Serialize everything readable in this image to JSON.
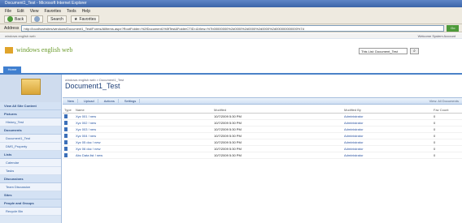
{
  "browser": {
    "title": "Document1_Test - Microsoft Internet Explorer",
    "menu": [
      "File",
      "Edit",
      "View",
      "Favorites",
      "Tools",
      "Help"
    ],
    "toolbar": {
      "back": "Back",
      "search": "Search",
      "favorites": "Favorites"
    },
    "address_label": "Address",
    "address": "http://localhost/sites/windows/Document1_Test/Forms/AllItems.aspx?RootFolder=%2fDocument1%5fTest&FolderCTID=&View=%7b00000000%2d0000%2d0000%2d0000%2d000000000000%7d",
    "go": "Go"
  },
  "site": {
    "top_left": "windows english web",
    "top_right": "Welcome System Account",
    "title": "windows english web",
    "search_placeholder": "This List: Document_Test",
    "home_tab": "Home"
  },
  "quick_launch": {
    "sections": [
      {
        "title": "View All Site Content",
        "items": []
      },
      {
        "title": "Pictures",
        "items": [
          "History_Test"
        ]
      },
      {
        "title": "Documents",
        "items": [
          "Document1_Test",
          "DMS_Property"
        ]
      },
      {
        "title": "Lists",
        "items": [
          "Calendar",
          "Tasks"
        ]
      },
      {
        "title": "Discussions",
        "items": [
          "Team Discussion"
        ]
      },
      {
        "title": "Sites",
        "items": []
      },
      {
        "title": "People and Groups",
        "items": [
          "Recycle Bin"
        ]
      }
    ]
  },
  "content": {
    "breadcrumb": "windows english web > Document1_Test",
    "title": "Document1_Test",
    "actions": [
      "New",
      "Upload",
      "Actions",
      "Settings"
    ],
    "view_label": "View: All Documents",
    "columns": [
      "Type",
      "Name",
      "Modified",
      "Modified By",
      "Fav Count"
    ],
    "rows": [
      {
        "name": "Xyz 001 ! new",
        "modified": "10/7/2009 5:30 PM",
        "by": "Administrator",
        "count": "0"
      },
      {
        "name": "Xyz 002 ! new",
        "modified": "10/7/2009 5:30 PM",
        "by": "Administrator",
        "count": "0"
      },
      {
        "name": "Xyz 003 ! new",
        "modified": "10/7/2009 5:30 PM",
        "by": "Administrator",
        "count": "0"
      },
      {
        "name": "Xyz 004 ! new",
        "modified": "10/7/2009 5:30 PM",
        "by": "Administrator",
        "count": "0"
      },
      {
        "name": "Xyz 05 doc ! new",
        "modified": "10/7/2009 5:30 PM",
        "by": "Administrator",
        "count": "0"
      },
      {
        "name": "Xyz 06 doc ! new",
        "modified": "10/7/2009 5:30 PM",
        "by": "Administrator",
        "count": "0"
      },
      {
        "name": "Abc Data list ! new",
        "modified": "10/7/2009 5:30 PM",
        "by": "Administrator",
        "count": "0"
      }
    ]
  }
}
